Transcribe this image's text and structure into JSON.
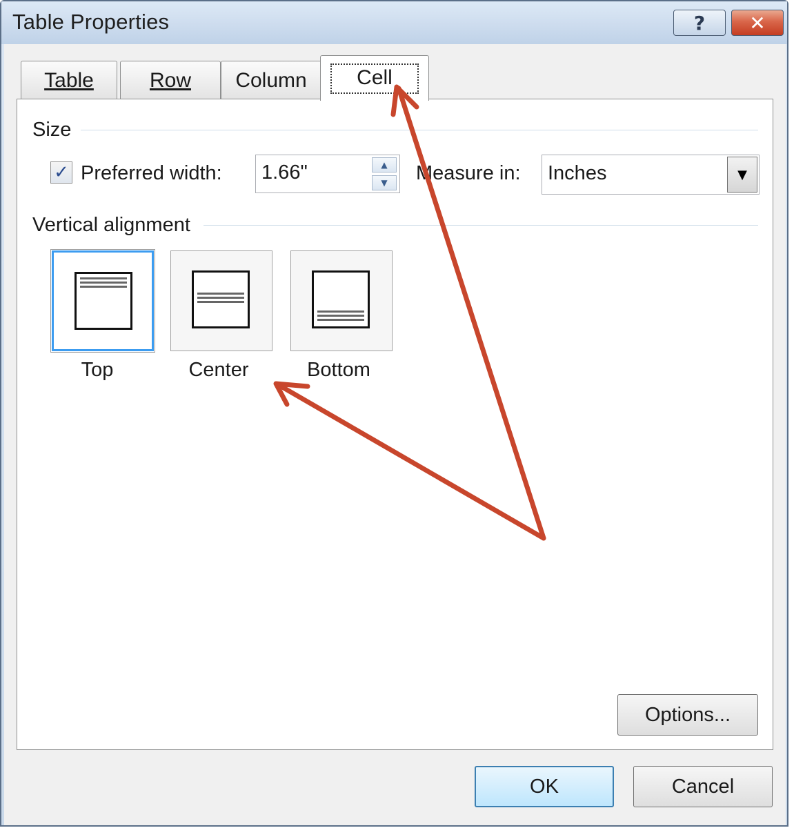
{
  "window": {
    "title": "Table Properties",
    "help_glyph": "?",
    "close_glyph": "✕"
  },
  "tabs": [
    {
      "label": "Table",
      "selected": false
    },
    {
      "label": "Row",
      "selected": false
    },
    {
      "label": "Column",
      "selected": false
    },
    {
      "label": "Cell",
      "selected": true
    }
  ],
  "size": {
    "group_label": "Size",
    "preferred_width_checked": true,
    "check_glyph": "✓",
    "preferred_width_label": "Preferred width:",
    "preferred_width_value": "1.66\"",
    "measure_in_label": "Measure in:",
    "measure_in_value": "Inches"
  },
  "vertical_alignment": {
    "group_label": "Vertical alignment",
    "options": [
      {
        "label": "Top",
        "selected": true
      },
      {
        "label": "Center",
        "selected": false
      },
      {
        "label": "Bottom",
        "selected": false
      }
    ]
  },
  "buttons": {
    "options": "Options...",
    "ok": "OK",
    "cancel": "Cancel"
  },
  "colors": {
    "annotation_arrow": "#c8462c",
    "selection_blue": "#3c9cf0"
  }
}
